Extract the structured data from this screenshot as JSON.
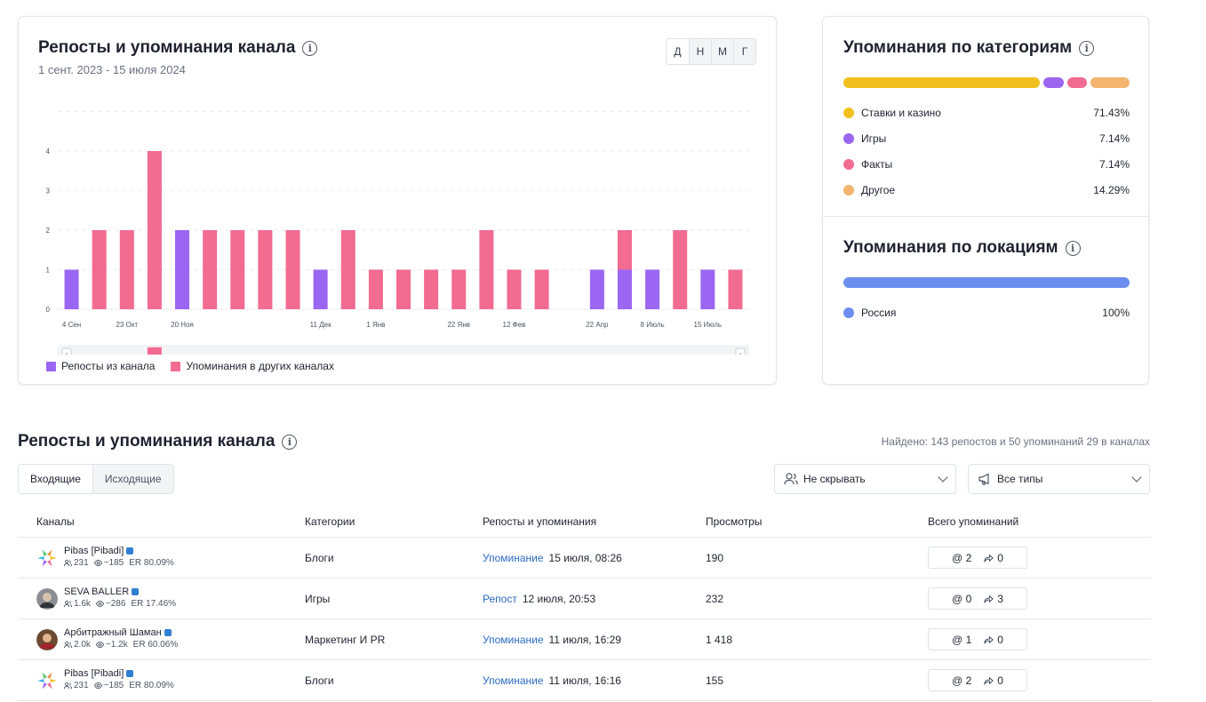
{
  "chart_card": {
    "title": "Репосты и упоминания канала",
    "date_range": "1 сент. 2023 - 15 июля 2024",
    "periods": [
      "Д",
      "Н",
      "М",
      "Г"
    ],
    "legend": [
      {
        "label": "Репосты из канала",
        "color": "#9b66f2"
      },
      {
        "label": "Упоминания в других каналах",
        "color": "#f26b91"
      }
    ]
  },
  "chart_data": {
    "type": "bar",
    "stacked": true,
    "y_ticks": [
      "0",
      "1",
      "2",
      "3",
      "4"
    ],
    "ylim": [
      0,
      5
    ],
    "x_labels": [
      {
        "index": 0,
        "text": "4 Сен"
      },
      {
        "index": 2,
        "text": "23 Окт"
      },
      {
        "index": 4,
        "text": "20 Ноя"
      },
      {
        "index": 9,
        "text": "11 Дек"
      },
      {
        "index": 11,
        "text": "1 Янв"
      },
      {
        "index": 14,
        "text": "22 Янв"
      },
      {
        "index": 16,
        "text": "12 Фев"
      },
      {
        "index": 19,
        "text": "22 Апр"
      },
      {
        "index": 21,
        "text": "8 Июль"
      },
      {
        "index": 23,
        "text": "15 Июль"
      }
    ],
    "series": [
      {
        "name": "Репосты из канала",
        "color": "#9b66f2",
        "values": [
          1,
          0,
          0,
          0,
          2,
          0,
          0,
          0,
          0,
          1,
          0,
          0,
          0,
          0,
          0,
          0,
          0,
          0,
          0,
          1,
          1,
          1,
          0,
          1,
          0
        ]
      },
      {
        "name": "Упоминания в других каналах",
        "color": "#f26b91",
        "values": [
          0,
          2,
          2,
          4,
          0,
          2,
          2,
          2,
          2,
          0,
          2,
          1,
          1,
          1,
          1,
          2,
          1,
          1,
          0,
          0,
          1,
          0,
          2,
          0,
          1
        ]
      }
    ],
    "grid": true
  },
  "categories": {
    "title": "Упоминания по категориям",
    "items": [
      {
        "label": "Ставки и казино",
        "value": "71.43%",
        "share": 71.43,
        "color": "#f2c01e"
      },
      {
        "label": "Игры",
        "value": "7.14%",
        "share": 7.14,
        "color": "#9b66f2"
      },
      {
        "label": "Факты",
        "value": "7.14%",
        "share": 7.14,
        "color": "#f26b91"
      },
      {
        "label": "Другое",
        "value": "14.29%",
        "share": 14.29,
        "color": "#f2b46e"
      }
    ]
  },
  "locations": {
    "title": "Упоминания по локациям",
    "items": [
      {
        "label": "Россия",
        "value": "100%",
        "share": 100,
        "color": "#6b8ded"
      }
    ]
  },
  "table_section": {
    "title": "Репосты и упоминания канала",
    "found": "Найдено: 143 репостов и 50 упоминаний 29 в каналах",
    "tabs": [
      "Входящие",
      "Исходящие"
    ],
    "filter_hide": "Не скрывать",
    "filter_type": "Все типы",
    "columns": [
      "Каналы",
      "Категории",
      "Репосты и упоминания",
      "Просмотры",
      "Всего упоминаний"
    ],
    "rows": [
      {
        "name": "Pibas [Pibadi]",
        "subs": "231",
        "views": "~185",
        "er": "ER 80.09%",
        "category": "Блоги",
        "type": "Упоминание",
        "date": "15 июля, 08:26",
        "views_total": "190",
        "mentions": "2",
        "reposts": "0",
        "avatar": "star"
      },
      {
        "name": "SEVA BALLER",
        "subs": "1.6k",
        "views": "~286",
        "er": "ER 17.46%",
        "category": "Игры",
        "type": "Репост",
        "date": "12 июля, 20:53",
        "views_total": "232",
        "mentions": "0",
        "reposts": "3",
        "avatar": "photo1"
      },
      {
        "name": "Арбитражный Шаман",
        "subs": "2.0k",
        "views": "~1.2k",
        "er": "ER 60.06%",
        "category": "Маркетинг И PR",
        "type": "Упоминание",
        "date": "11 июля, 16:29",
        "views_total": "1 418",
        "mentions": "1",
        "reposts": "0",
        "avatar": "photo2"
      },
      {
        "name": "Pibas [Pibadi]",
        "subs": "231",
        "views": "~185",
        "er": "ER 80.09%",
        "category": "Блоги",
        "type": "Упоминание",
        "date": "11 июля, 16:16",
        "views_total": "155",
        "mentions": "2",
        "reposts": "0",
        "avatar": "star"
      }
    ]
  }
}
